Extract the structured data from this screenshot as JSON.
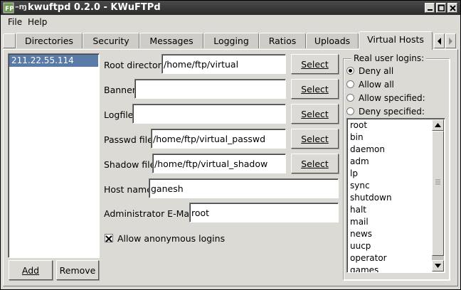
{
  "window": {
    "title": "kwuftpd 0.2.0 - KWuFTPd"
  },
  "menubar": {
    "items": [
      {
        "label": "File"
      },
      {
        "label": "Help"
      }
    ]
  },
  "tabs": [
    {
      "label": "Directories",
      "active": false
    },
    {
      "label": "Security",
      "active": false
    },
    {
      "label": "Messages",
      "active": false
    },
    {
      "label": "Logging",
      "active": false
    },
    {
      "label": "Ratios",
      "active": false
    },
    {
      "label": "Uploads",
      "active": false
    },
    {
      "label": "Virtual Hosts",
      "active": true
    }
  ],
  "hosts": {
    "items": [
      "211.22.55.114"
    ],
    "selected": "211.22.55.114",
    "add_label": "Add",
    "remove_label": "Remove"
  },
  "form": {
    "root_directory": {
      "label": "Root directory:",
      "value": "/home/ftp/virtual"
    },
    "banner": {
      "label": "Banner:",
      "value": ""
    },
    "logfile": {
      "label": "Logfile:",
      "value": ""
    },
    "passwd_file": {
      "label": "Passwd file:",
      "value": "/home/ftp/virtual_passwd"
    },
    "shadow_file": {
      "label": "Shadow file:",
      "value": "/home/ftp/virtual_shadow"
    },
    "host_name": {
      "label": "Host name:",
      "value": "ganesh"
    },
    "admin_email": {
      "label": "Administrator E-Mail:",
      "value": "root"
    },
    "select_label": "Select",
    "anonymous": {
      "label": "Allow anonymous logins",
      "checked": true
    }
  },
  "real_user_logins": {
    "title": "Real user logins:",
    "options": [
      {
        "label": "Deny all",
        "selected": true
      },
      {
        "label": "Allow all",
        "selected": false
      },
      {
        "label": "Allow specified:",
        "selected": false
      },
      {
        "label": "Deny specified:",
        "selected": false
      }
    ],
    "users": [
      "root",
      "bin",
      "daemon",
      "adm",
      "lp",
      "sync",
      "shutdown",
      "halt",
      "mail",
      "news",
      "uucp",
      "operator",
      "games"
    ]
  },
  "colors": {
    "selection": "#5a7aa8",
    "titlebar": "#2c2c2c",
    "background": "#dcdad5"
  }
}
